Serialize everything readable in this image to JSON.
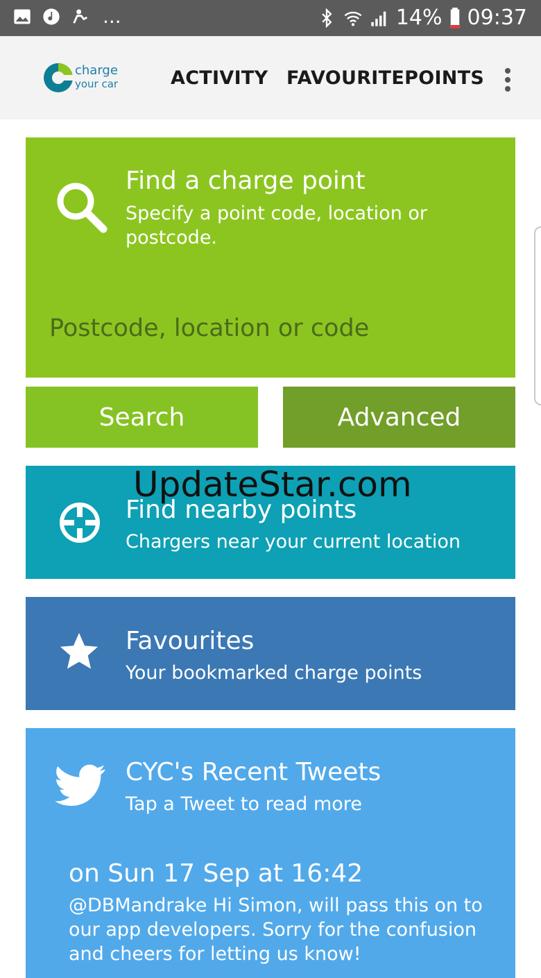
{
  "status_bar": {
    "left_icons": [
      "gallery-icon",
      "music-icon",
      "accessibility-icon"
    ],
    "more": "...",
    "battery": "14%",
    "time": "09:37"
  },
  "app_bar": {
    "logo_line1": "charge",
    "logo_line2": "your car",
    "menu": [
      "ACTIVITY",
      "FAVOURITEPOINTS"
    ]
  },
  "find": {
    "title": "Find a charge point",
    "subtitle": "Specify a point code, location or postcode.",
    "placeholder": "Postcode, location or code",
    "search_label": "Search",
    "advanced_label": "Advanced"
  },
  "nearby": {
    "title": "Find nearby points",
    "subtitle": "Chargers near your current location"
  },
  "favourites": {
    "title": "Favourites",
    "subtitle": "Your bookmarked charge points"
  },
  "tweets": {
    "title": "CYC's Recent Tweets",
    "subtitle": "Tap a Tweet to read more",
    "date": "on Sun 17 Sep at 16:42",
    "text": "@DBMandrake Hi Simon, will pass this on to our app developers. Sorry for the confusion and cheers for letting us know!"
  },
  "watermark": "UpdateStar.com",
  "colors": {
    "find": "#8cc520",
    "search": "#85c324",
    "advanced": "#729e2a",
    "nearby": "#0ea0b4",
    "favourites": "#3b78b4",
    "tweets": "#51a9ea"
  }
}
